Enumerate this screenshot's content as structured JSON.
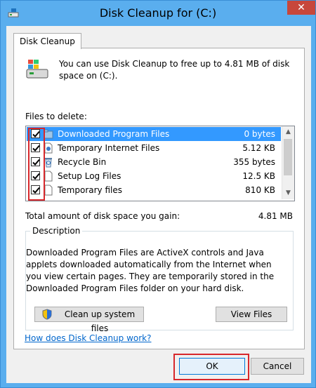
{
  "window": {
    "title": "Disk Cleanup for  (C:)",
    "close_glyph": "✕"
  },
  "tab": {
    "label": "Disk Cleanup"
  },
  "intro": {
    "text": "You can use Disk Cleanup to free up to 4.81 MB of disk space on  (C:)."
  },
  "files": {
    "label": "Files to delete:",
    "items": [
      {
        "name": "Downloaded Program Files",
        "size": "0 bytes",
        "checked": true,
        "selected": true,
        "icon": "folder-icon"
      },
      {
        "name": "Temporary Internet Files",
        "size": "5.12 KB",
        "checked": true,
        "selected": false,
        "icon": "document-icon"
      },
      {
        "name": "Recycle Bin",
        "size": "355 bytes",
        "checked": true,
        "selected": false,
        "icon": "recycle-bin-icon"
      },
      {
        "name": "Setup Log Files",
        "size": "12.5 KB",
        "checked": true,
        "selected": false,
        "icon": "document-icon"
      },
      {
        "name": "Temporary files",
        "size": "810 KB",
        "checked": true,
        "selected": false,
        "icon": "document-icon"
      }
    ]
  },
  "total": {
    "label": "Total amount of disk space you gain:",
    "value": "4.81 MB"
  },
  "description": {
    "title": "Description",
    "text": "Downloaded Program Files are ActiveX controls and Java applets downloaded automatically from the Internet when you view certain pages. They are temporarily stored in the Downloaded Program Files folder on your hard disk."
  },
  "buttons": {
    "clean_system": "Clean up system files",
    "view_files": "View Files",
    "ok": "OK",
    "cancel": "Cancel"
  },
  "help": {
    "link": "How does Disk Cleanup work?"
  },
  "colors": {
    "highlight": "#3399ff",
    "annotation_red": "#d8272b",
    "title_bar": "#5aaeee"
  }
}
